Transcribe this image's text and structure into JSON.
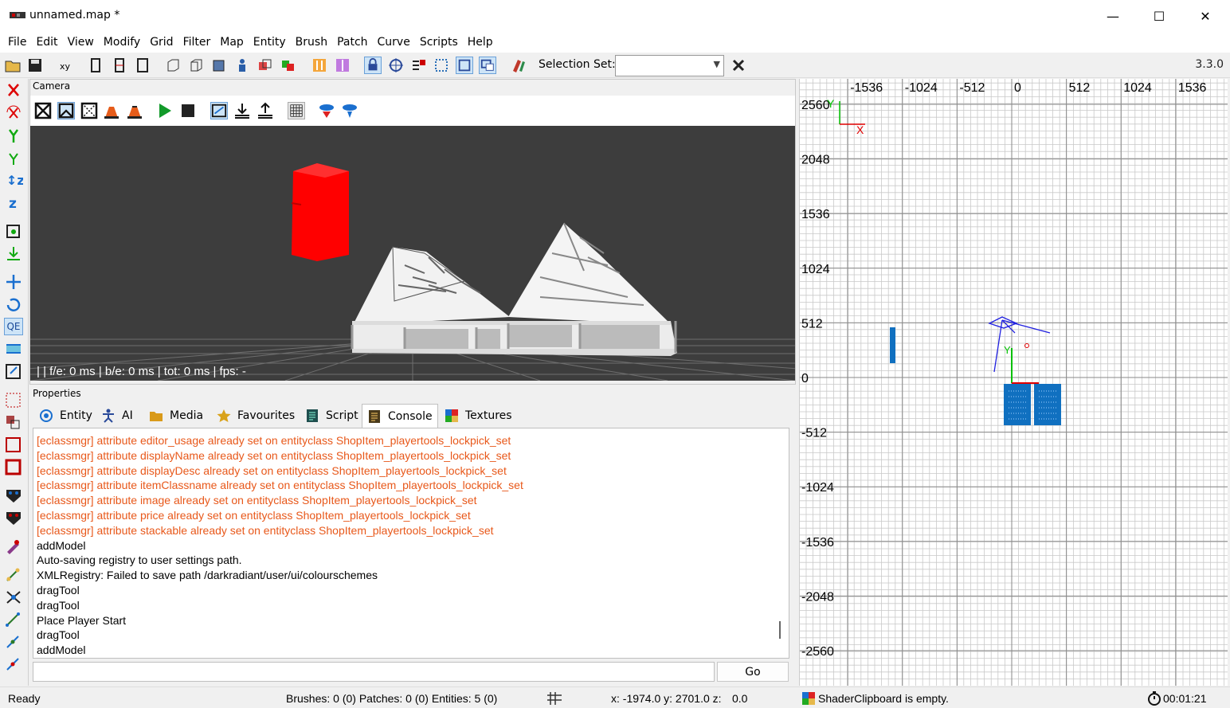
{
  "window": {
    "title": "unnamed.map *",
    "minimize_glyph": "—",
    "maximize_glyph": "☐",
    "close_glyph": "✕"
  },
  "menu": [
    "File",
    "Edit",
    "View",
    "Modify",
    "Grid",
    "Filter",
    "Map",
    "Entity",
    "Brush",
    "Patch",
    "Curve",
    "Scripts",
    "Help"
  ],
  "toolbar": {
    "selection_set_label": "Selection Set:",
    "selection_set_value": "",
    "version": "3.3.0"
  },
  "left_tools": {
    "qe_label": "QE"
  },
  "camera": {
    "panel_label": "Camera",
    "stats": " |  | f/e: 0 ms | b/e: 0 ms | tot: 0 ms | fps: -"
  },
  "properties": {
    "panel_label": "Properties",
    "tabs": [
      {
        "label": "Entity",
        "icon": "entity-icon"
      },
      {
        "label": "AI",
        "icon": "ai-icon"
      },
      {
        "label": "Media",
        "icon": "folder-icon"
      },
      {
        "label": "Favourites",
        "icon": "star-icon"
      },
      {
        "label": "Script",
        "icon": "script-icon"
      },
      {
        "label": "Console",
        "icon": "console-icon",
        "active": true
      },
      {
        "label": "Textures",
        "icon": "textures-icon"
      }
    ]
  },
  "console": {
    "lines": [
      {
        "text": "[eclassmgr] attribute editor_usage already set on entityclass ShopItem_playertools_lockpick_set",
        "warn": true
      },
      {
        "text": "[eclassmgr] attribute displayName already set on entityclass ShopItem_playertools_lockpick_set",
        "warn": true
      },
      {
        "text": "[eclassmgr] attribute displayDesc already set on entityclass ShopItem_playertools_lockpick_set",
        "warn": true
      },
      {
        "text": "[eclassmgr] attribute itemClassname already set on entityclass ShopItem_playertools_lockpick_set",
        "warn": true
      },
      {
        "text": "[eclassmgr] attribute image already set on entityclass ShopItem_playertools_lockpick_set",
        "warn": true
      },
      {
        "text": "[eclassmgr] attribute price already set on entityclass ShopItem_playertools_lockpick_set",
        "warn": true
      },
      {
        "text": "[eclassmgr] attribute stackable already set on entityclass ShopItem_playertools_lockpick_set",
        "warn": true
      },
      {
        "text": "addModel",
        "warn": false
      },
      {
        "text": "Auto-saving registry to user settings path.",
        "warn": false
      },
      {
        "text": "XMLRegistry: Failed to save path /darkradiant/user/ui/colourschemes",
        "warn": false
      },
      {
        "text": "dragTool",
        "warn": false
      },
      {
        "text": "dragTool",
        "warn": false
      },
      {
        "text": "Place Player Start",
        "warn": false
      },
      {
        "text": "dragTool",
        "warn": false
      },
      {
        "text": "addModel",
        "warn": false
      }
    ],
    "input_value": "",
    "go_label": "Go"
  },
  "ortho": {
    "x_labels": [
      "-1536",
      "-1024",
      "-512",
      "0",
      "512",
      "1024",
      "1536"
    ],
    "y_labels": [
      "2560",
      "2048",
      "1536",
      "1024",
      "512",
      "0",
      "-512",
      "-1024",
      "-1536",
      "-2048",
      "-2560"
    ],
    "axis_x_label": "X",
    "axis_y_label": "Y"
  },
  "status": {
    "ready": "Ready",
    "counts": "Brushes: 0 (0) Patches: 0 (0) Entities: 5 (0)",
    "coords": "x:  -1974.0 y:  2701.0 z:",
    "z_value": "0.0",
    "clipboard": "ShaderClipboard is empty.",
    "timer": "00:01:21"
  },
  "colors": {
    "warning_text": "#e8581a",
    "camera_bg": "#3d3d3d",
    "ortho_grid": "#c8c8c8",
    "selected_brush": "#ff0000",
    "entity_blue": "#1070c0"
  }
}
